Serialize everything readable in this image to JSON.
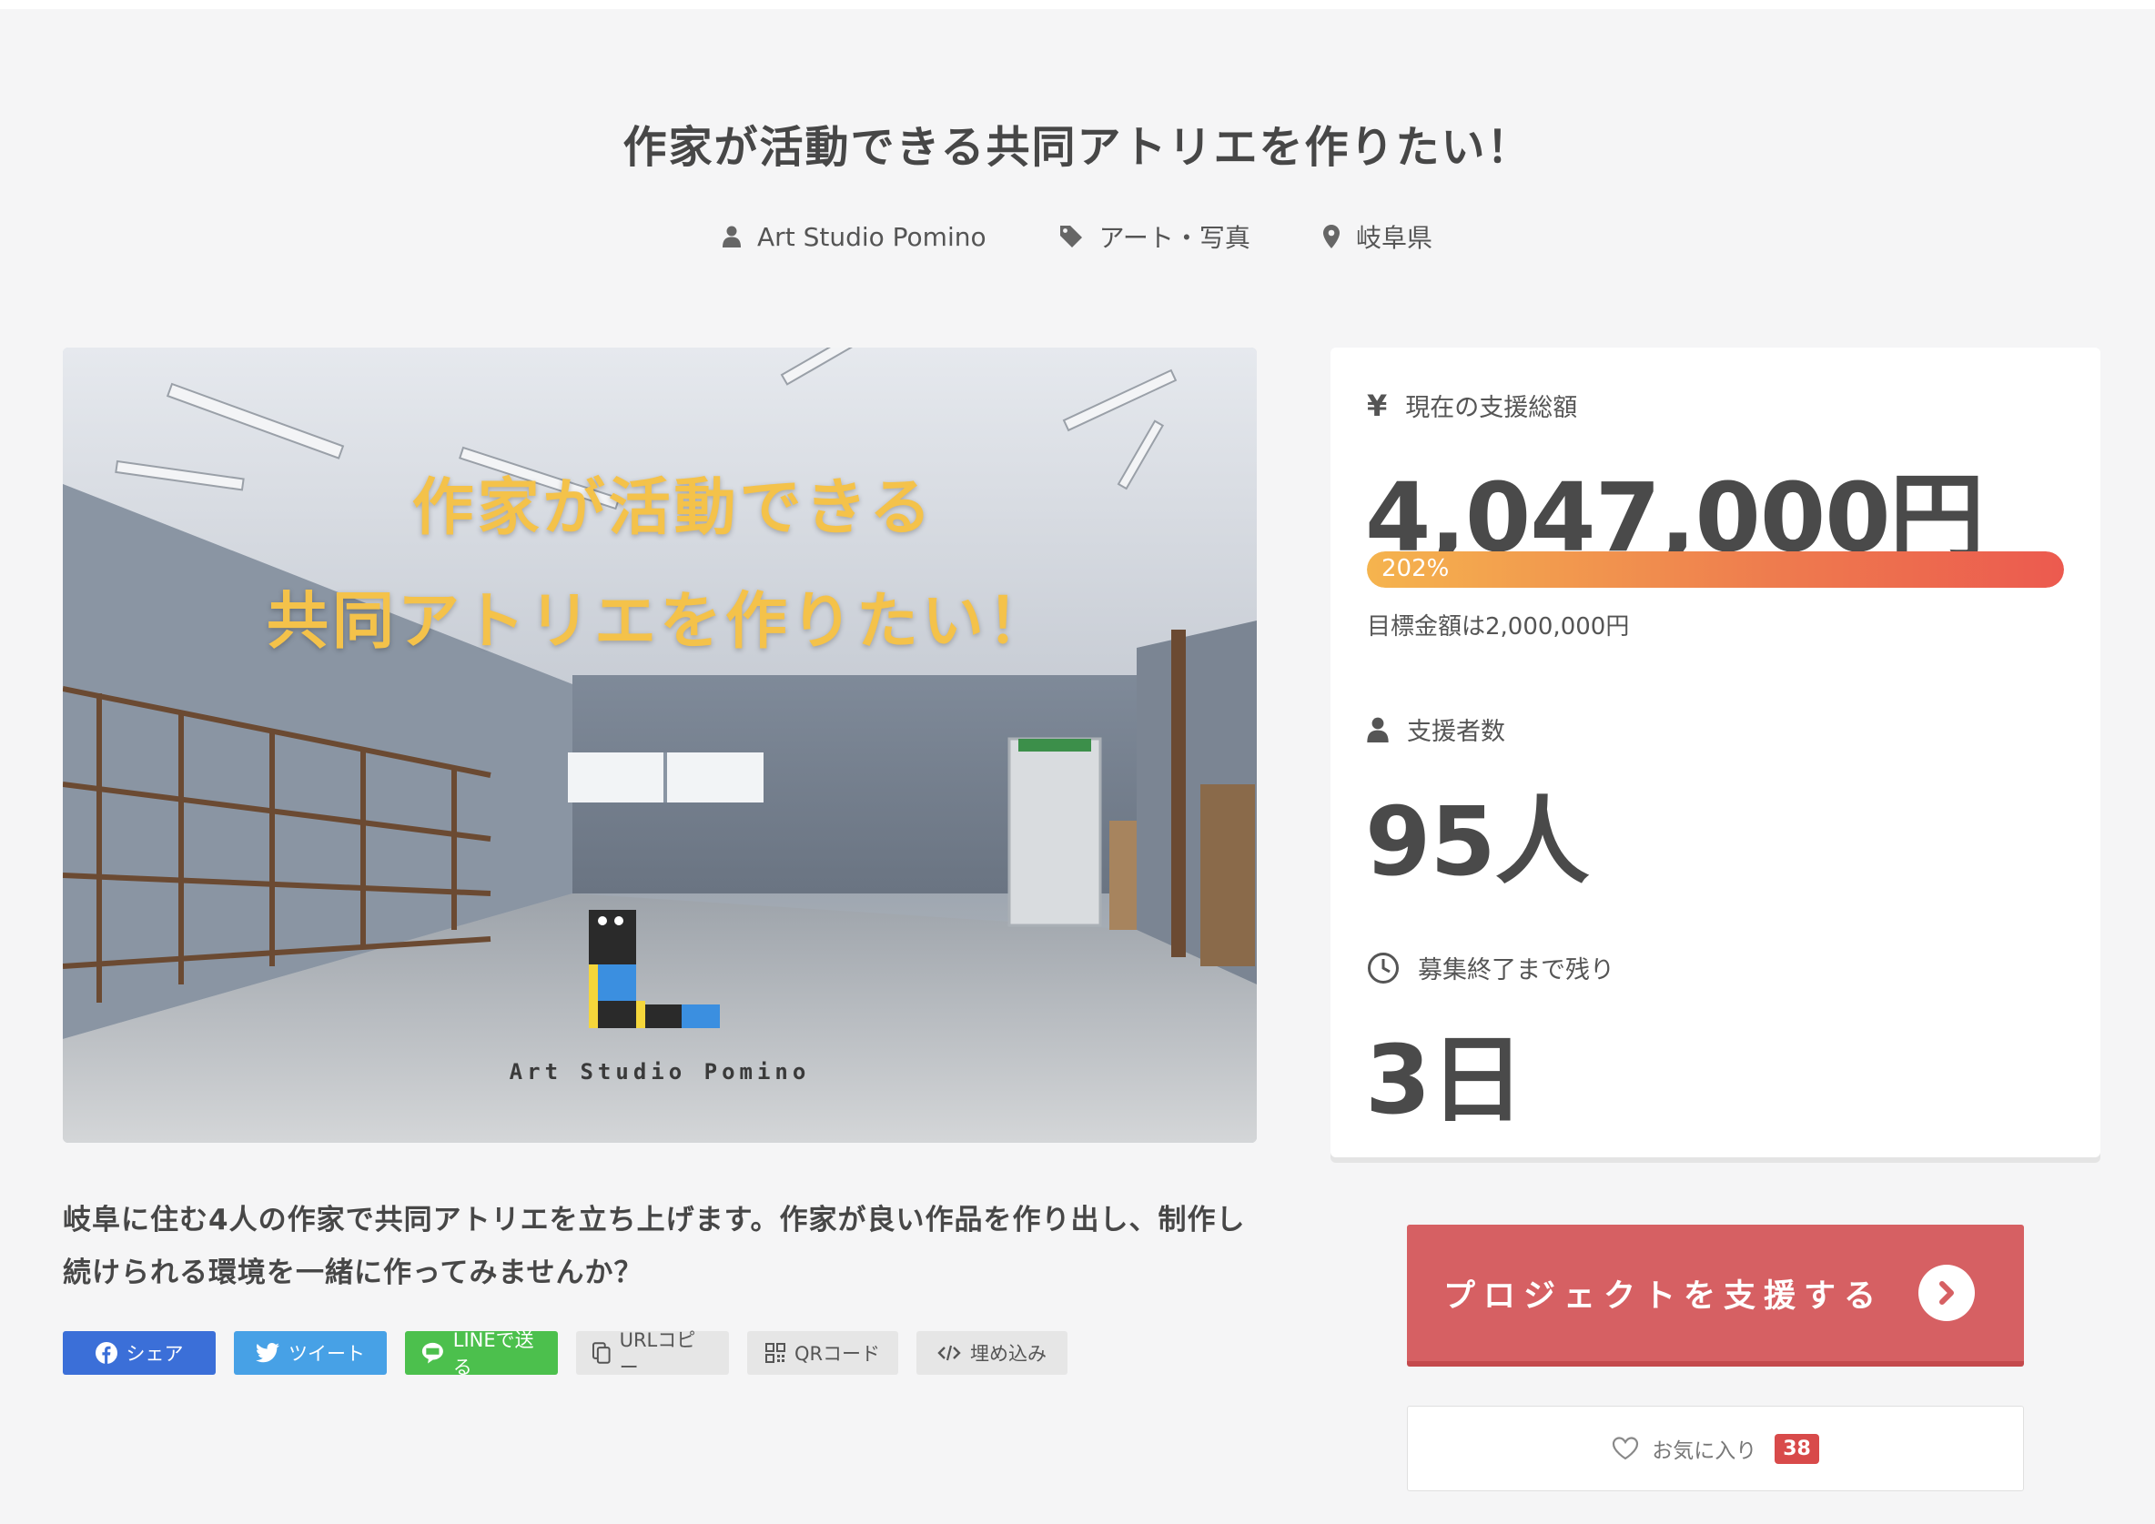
{
  "project": {
    "title": "作家が活動できる共同アトリエを作りたい！",
    "owner": "Art Studio Pomino",
    "category": "アート・写真",
    "location": "岐阜県"
  },
  "hero": {
    "line1": "作家が活動できる",
    "line2": "共同アトリエを作りたい！",
    "logo_text": "Art Studio Pomino"
  },
  "description": "岐阜に住む4人の作家で共同アトリエを立ち上げます。作家が良い作品を作り出し、制作し続けられる環境を一緒に作ってみませんか？",
  "share": {
    "facebook": "シェア",
    "twitter": "ツイート",
    "line": "LINEで送る",
    "url_copy": "URLコピー",
    "qr": "QRコード",
    "embed": "埋め込み"
  },
  "stats": {
    "amount_label": "現在の支援総額",
    "amount_value": "4,047,000円",
    "progress_text": "202%",
    "progress_fraction": 1.0,
    "goal_text": "目標金額は2,000,000円",
    "supporters_label": "支援者数",
    "supporters_value": "95人",
    "remaining_label": "募集終了まで残り",
    "remaining_value": "3日"
  },
  "actions": {
    "support_label": "プロジェクトを支援する",
    "favorite_label": "お気に入り",
    "favorite_count": "38"
  },
  "colors": {
    "support_button": "#d66063",
    "facebook": "#3b6fd8",
    "twitter": "#47a1e6",
    "line": "#4cc04d",
    "progress_start": "#f5b44e",
    "progress_end": "#ec5a4f",
    "hero_text": "#f4c24a"
  },
  "icons": {
    "owner": "user-icon",
    "category": "tag-icon",
    "location": "map-pin-icon",
    "amount": "yen-icon",
    "supporters": "user-icon",
    "remaining": "clock-icon"
  }
}
